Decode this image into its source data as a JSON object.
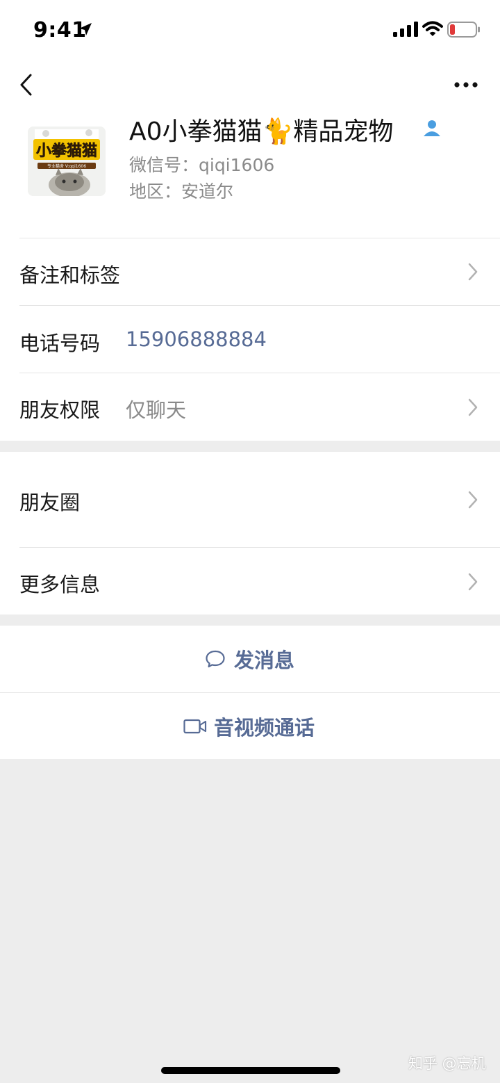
{
  "status_bar": {
    "time": "9:41",
    "icons": [
      "location-arrow-icon",
      "cellular-signal-icon",
      "wifi-icon",
      "battery-low-icon"
    ],
    "battery_color": "#e03a3a"
  },
  "nav": {
    "back_icon": "chevron-left-icon",
    "more_icon": "more-dots-icon"
  },
  "profile": {
    "name": "A0小拳猫猫🐈精品宠物",
    "wechat_id": "微信号：qiqi1606",
    "region": "地区：安道尔",
    "verified_icon": "contact-person-icon",
    "avatar": {
      "title_text": "小拳猫猫",
      "ribbon_text": "专业猫舍 V:qqi1606"
    }
  },
  "rows": {
    "remarks_tags": {
      "label": "备注和标签"
    },
    "phone": {
      "label": "电话号码",
      "value": "15906888884"
    },
    "friend_permission": {
      "label": "朋友权限",
      "value": "仅聊天"
    },
    "moments": {
      "label": "朋友圈"
    },
    "more_info": {
      "label": "更多信息"
    }
  },
  "actions": {
    "send_message": {
      "label": "发消息",
      "icon": "chat-bubble-icon"
    },
    "av_call": {
      "label": "音视频通话",
      "icon": "video-camera-icon"
    }
  },
  "watermark": "知乎 @忘机",
  "colors": {
    "link_blue": "#576b95",
    "verified_blue": "#4a9ee0",
    "background_gray": "#ededed"
  }
}
